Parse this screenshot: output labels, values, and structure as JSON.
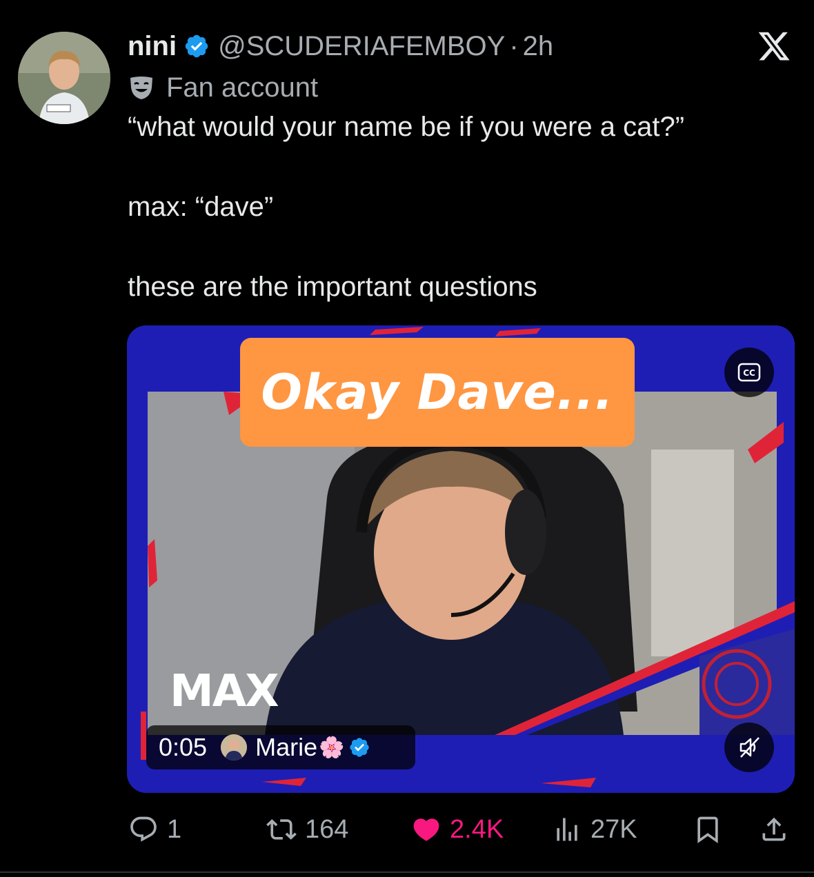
{
  "tweet": {
    "display_name": "nini",
    "handle": "@SCUDERIAFEMBOY",
    "separator": "·",
    "time": "2h",
    "label": "Fan account",
    "text_lines": [
      "“what would your name be if you were a cat?”",
      "max: “dave”",
      "these are the important questions"
    ]
  },
  "icons": {
    "verified": "verified-badge-icon",
    "label": "theater-mask-icon",
    "close": "x-logo-icon",
    "captions": "closed-captions-icon",
    "mute": "muted-speaker-icon",
    "reply": "reply-icon",
    "repost": "repost-icon",
    "like": "heart-icon",
    "views": "views-icon",
    "bookmark": "bookmark-icon",
    "share": "share-icon"
  },
  "media": {
    "caption": "Okay Dave...",
    "name_overlay": "MAX",
    "timestamp": "0:05",
    "uploader": "Marie",
    "uploader_emoji": "🌸"
  },
  "actions": {
    "replies": "1",
    "reposts": "164",
    "likes": "2.4K",
    "views": "27K"
  },
  "colors": {
    "background": "#000000",
    "text": "#e7e9ea",
    "secondary_text": "#a7adb2",
    "verified": "#1d9bf0",
    "like": "#f91880",
    "caption_box": "#ff9642",
    "stream_frame": "#1e1eb4"
  }
}
